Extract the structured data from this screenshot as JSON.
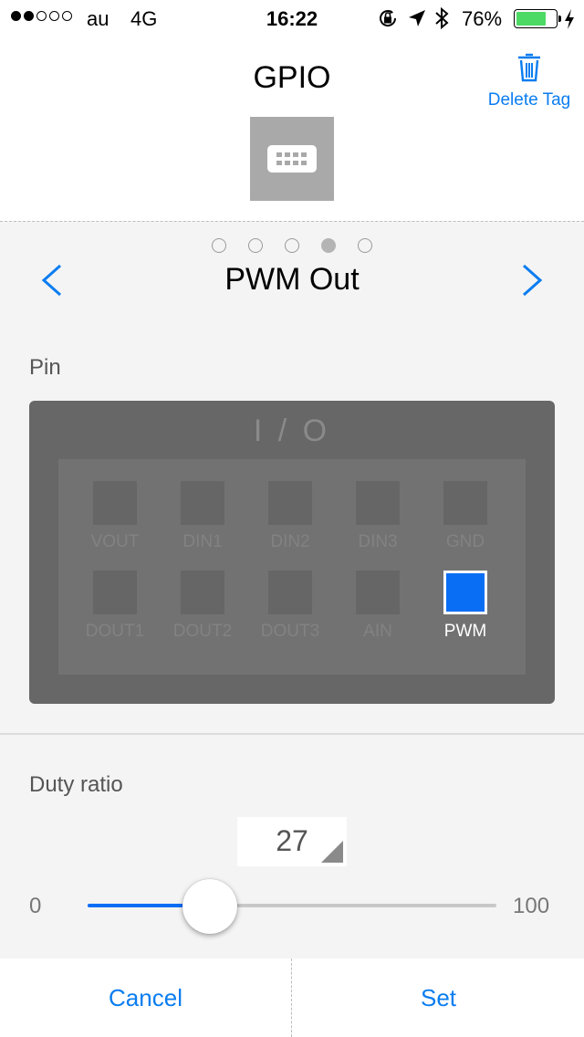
{
  "status_bar": {
    "carrier": "au",
    "network": "4G",
    "time": "16:22",
    "battery_percent": "76%",
    "battery_level": 0.76,
    "signal_strength": 2,
    "icons": [
      "orientation-lock-icon",
      "location-arrow-icon",
      "bluetooth-icon",
      "battery-icon",
      "charging-bolt-icon"
    ]
  },
  "header": {
    "title": "GPIO",
    "delete_label": "Delete Tag",
    "tag_icon": "keyboard-icon"
  },
  "mode": {
    "title": "PWM Out",
    "page_count": 5,
    "active_page": 4
  },
  "pin_section": {
    "label": "Pin",
    "box_title": "I / O",
    "row1": [
      "VOUT",
      "DIN1",
      "DIN2",
      "DIN3",
      "GND"
    ],
    "row2": [
      "DOUT1",
      "DOUT2",
      "DOUT3",
      "AIN",
      "PWM"
    ],
    "selected": "PWM"
  },
  "duty": {
    "label": "Duty ratio",
    "value": "27",
    "min": "0",
    "max": "100",
    "slider_fraction": 0.3
  },
  "buttons": {
    "cancel": "Cancel",
    "set": "Set"
  },
  "colors": {
    "accent": "#0a7df0",
    "selected_pin": "#0a6ef5",
    "battery_fill": "#4cd964"
  }
}
